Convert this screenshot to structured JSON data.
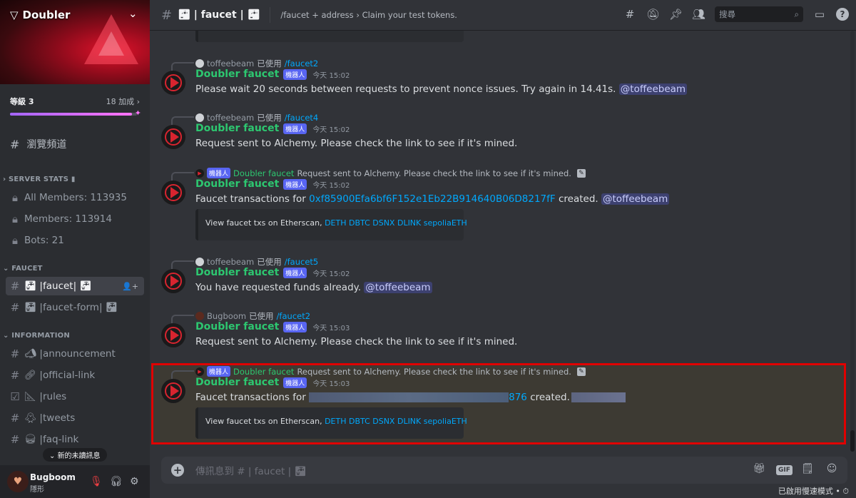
{
  "server": {
    "name": "Doubler",
    "boost_level": "等級 3",
    "boost_count": "18 加成",
    "boost_progress": 0.96
  },
  "sidebar": {
    "browse": "瀏覽頻道",
    "categories": [
      {
        "label": "SERVER STATS",
        "channels": [
          {
            "icon": "lock-icon",
            "label": "All Members: 113935"
          },
          {
            "icon": "lock-icon",
            "label": "Members: 113914"
          },
          {
            "icon": "lock-icon",
            "label": "Bots: 21"
          }
        ]
      },
      {
        "label": "FAUCET",
        "channels": [
          {
            "icon": "hash-icon",
            "label": "faucet",
            "active": true
          },
          {
            "icon": "hash-icon",
            "label": "faucet-form"
          }
        ]
      },
      {
        "label": "INFORMATION",
        "channels": [
          {
            "icon": "hash-icon",
            "label": "announcement"
          },
          {
            "icon": "hash-icon",
            "label": "official-link"
          },
          {
            "icon": "hash-icon",
            "label": "rules"
          },
          {
            "icon": "hash-icon",
            "label": "tweets"
          },
          {
            "icon": "hash-icon",
            "label": "faq-link"
          }
        ]
      }
    ],
    "new_unread": "新的未讀訊息"
  },
  "user": {
    "name": "Bugboom",
    "status": "隱形"
  },
  "header": {
    "channel": "faucet",
    "topic": "/faucet + address › Claim your test tokens.",
    "search_placeholder": "搜尋"
  },
  "messages": [
    {
      "reply_user": "toffeebeam",
      "reply_verb": "已使用",
      "reply_cmd": "/faucet2",
      "author": "Doubler faucet",
      "bot_tag": "機器人",
      "time": "今天 15:02",
      "text": "Please wait 20 seconds between requests to prevent nonce issues. Try again in 14.41s.",
      "mention": "@toffeebeam"
    },
    {
      "reply_user": "toffeebeam",
      "reply_verb": "已使用",
      "reply_cmd": "/faucet4",
      "author": "Doubler faucet",
      "bot_tag": "機器人",
      "time": "今天 15:02",
      "text": "Request sent to Alchemy. Please check the link to see if it's mined."
    },
    {
      "reply_bot_tag": "機器人",
      "reply_user": "Doubler faucet",
      "reply_text": "Request sent to Alchemy. Please check the link to see if it's mined.",
      "author": "Doubler faucet",
      "bot_tag": "機器人",
      "time": "今天 15:02",
      "text_prefix": "Faucet transactions for",
      "address": "0xf85900Efa6bf6F152e1Eb22B914640B06D8217fF",
      "text_suffix": "created.",
      "mention": "@toffeebeam",
      "embed_text": "View faucet txs on Etherscan,",
      "embed_links": "DETH DBTC DSNX DLINK sepoliaETH"
    },
    {
      "reply_user": "toffeebeam",
      "reply_verb": "已使用",
      "reply_cmd": "/faucet5",
      "author": "Doubler faucet",
      "bot_tag": "機器人",
      "time": "今天 15:02",
      "text": "You have requested funds already.",
      "mention": "@toffeebeam"
    },
    {
      "reply_user": "Bugboom",
      "reply_verb": "已使用",
      "reply_cmd": "/faucet2",
      "author": "Doubler faucet",
      "bot_tag": "機器人",
      "time": "今天 15:03",
      "text": "Request sent to Alchemy. Please check the link to see if it's mined."
    },
    {
      "reply_bot_tag": "機器人",
      "reply_user": "Doubler faucet",
      "reply_text": "Request sent to Alchemy. Please check the link to see if it's mined.",
      "author": "Doubler faucet",
      "bot_tag": "機器人",
      "time": "今天 15:03",
      "text_prefix": "Faucet transactions for",
      "address_tail": "876",
      "text_suffix": "created.",
      "embed_text": "View faucet txs on Etherscan,",
      "embed_links": "DETH DBTC DSNX DLINK sepoliaETH"
    }
  ],
  "composer": {
    "placeholder": "傳訊息到 # | faucet |"
  },
  "footer": {
    "slow_mode": "已啟用慢速模式 •"
  },
  "colors": {
    "bot_name": "#2dc770",
    "link": "#00a8fc",
    "highlight_border": "#e00000",
    "bot_tag": "#5865f2"
  }
}
